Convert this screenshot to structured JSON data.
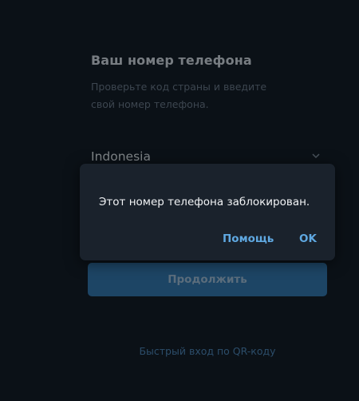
{
  "login": {
    "title": "Ваш номер телефона",
    "hint": "Проверьте код страны и введите свой номер телефона.",
    "country": "Indonesia",
    "continue_label": "Продолжить",
    "qr_link": "Быстрый вход по QR-коду"
  },
  "dialog": {
    "message": "Этот номер телефона заблокирован.",
    "help_label": "Помощь",
    "ok_label": "OK"
  },
  "colors": {
    "background": "#0b1117",
    "dialog_bg": "#1a222c",
    "accent": "#5fa8e1",
    "button_bg": "#1d4565"
  },
  "icons": {
    "country_dropdown": "chevron-down-icon"
  }
}
